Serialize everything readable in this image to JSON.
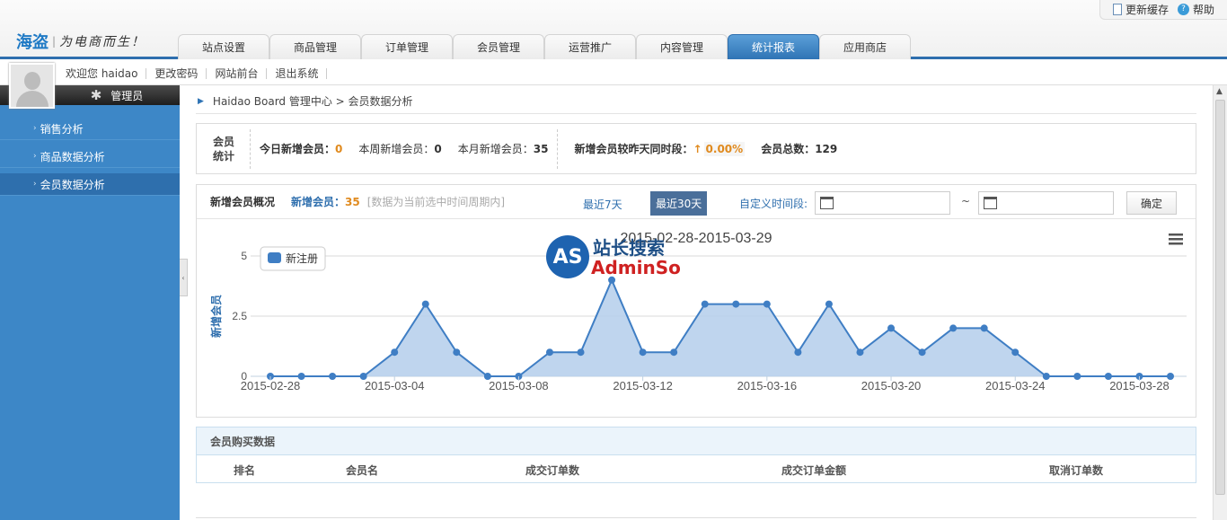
{
  "header": {
    "brand": "海盗",
    "slogan": "为电商而生！",
    "links": {
      "update_cache": "更新缓存",
      "help": "帮助"
    },
    "tabs": [
      "站点设置",
      "商品管理",
      "订单管理",
      "会员管理",
      "运营推广",
      "内容管理",
      "统计报表",
      "应用商店"
    ],
    "active_tab": "统计报表"
  },
  "userbar": {
    "welcome": "欢迎您 haidao",
    "change_password": "更改密码",
    "site_front": "网站前台",
    "logout": "退出系统"
  },
  "sidebar": {
    "role": "管理员",
    "items": [
      {
        "label": "销售分析",
        "active": false
      },
      {
        "label": "商品数据分析",
        "active": false
      },
      {
        "label": "会员数据分析",
        "active": true
      }
    ]
  },
  "breadcrumb": "Haidao Board 管理中心 > 会员数据分析",
  "stats": {
    "label": "会员统计",
    "today_label": "今日新增会员：",
    "today": "0",
    "week_label": "本周新增会员：",
    "week": "0",
    "month_label": "本月新增会员：",
    "month": "35",
    "compare_label": "新增会员较昨天同时段：",
    "compare": "0.00%",
    "total_label": "会员总数：",
    "total": "129"
  },
  "filter": {
    "title": "新增会员概况",
    "new_label": "新增会员：",
    "new_value": "35",
    "hint": "[数据为当前选中时间周期内]",
    "btn_7": "最近7天",
    "btn_30": "最近30天",
    "custom_label": "自定义时间段:",
    "tilde": "~",
    "confirm": "确定"
  },
  "watermark": {
    "logo": "AS",
    "cn": "站长搜索",
    "en": "AdminSo"
  },
  "chart_data": {
    "type": "area",
    "title": "2015-02-28-2015-03-29",
    "ylabel": "新增会员",
    "legend": "新注册",
    "ylim": [
      0,
      5
    ],
    "yticks": [
      "0",
      "2.5",
      "5"
    ],
    "x": [
      "2015-02-28",
      "2015-03-01",
      "2015-03-02",
      "2015-03-03",
      "2015-03-04",
      "2015-03-05",
      "2015-03-06",
      "2015-03-07",
      "2015-03-08",
      "2015-03-09",
      "2015-03-10",
      "2015-03-11",
      "2015-03-12",
      "2015-03-13",
      "2015-03-14",
      "2015-03-15",
      "2015-03-16",
      "2015-03-17",
      "2015-03-18",
      "2015-03-19",
      "2015-03-20",
      "2015-03-21",
      "2015-03-22",
      "2015-03-23",
      "2015-03-24",
      "2015-03-25",
      "2015-03-26",
      "2015-03-27",
      "2015-03-28",
      "2015-03-29"
    ],
    "xtick_labels": [
      "2015-02-28",
      "2015-03-04",
      "2015-03-08",
      "2015-03-12",
      "2015-03-16",
      "2015-03-20",
      "2015-03-24",
      "2015-03-28"
    ],
    "values": [
      0,
      0,
      0,
      0,
      1,
      3,
      1,
      0,
      0,
      1,
      1,
      4,
      1,
      1,
      3,
      3,
      3,
      1,
      3,
      1,
      2,
      1,
      2,
      2,
      1,
      0,
      0,
      0,
      0,
      0
    ],
    "color": "#3f7ec4",
    "fill": "#b8d0ec"
  },
  "purchase": {
    "title": "会员购买数据",
    "columns": [
      "排名",
      "会员名",
      "成交订单数",
      "成交订单金额",
      "取消订单数"
    ]
  }
}
